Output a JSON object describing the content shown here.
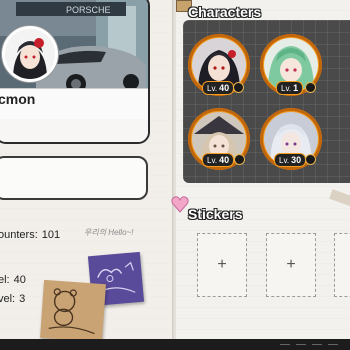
{
  "profile": {
    "name": "cmon",
    "banner_text": "PORSCHE"
  },
  "stats": [
    {
      "label": "ounters:",
      "value": "101"
    },
    {
      "label": "el:",
      "value": "40"
    },
    {
      "label": "vel:",
      "value": "3"
    }
  ],
  "doodle_text": "우리의 Hello~!",
  "characters": {
    "title": "Characters",
    "items": [
      {
        "level_label": "Lv.",
        "level": "40",
        "element": "wind",
        "portrait": "dark-hair-red-eyes"
      },
      {
        "level_label": "Lv.",
        "level": "1",
        "element": "leaf",
        "portrait": "green-hair-girl"
      },
      {
        "level_label": "Lv.",
        "level": "40",
        "element": "leaf",
        "portrait": "witch-hat-girl"
      },
      {
        "level_label": "Lv.",
        "level": "30",
        "element": "leaf",
        "portrait": "white-hair-boy"
      }
    ]
  },
  "stickers": {
    "title": "Stickers",
    "slots": [
      "+",
      "+",
      "+"
    ]
  },
  "colors": {
    "accent_orange": "#f39c1e",
    "panel_dark": "#4a4a4a",
    "note_purple": "#5a4a9a",
    "note_brown": "#c9a374"
  }
}
